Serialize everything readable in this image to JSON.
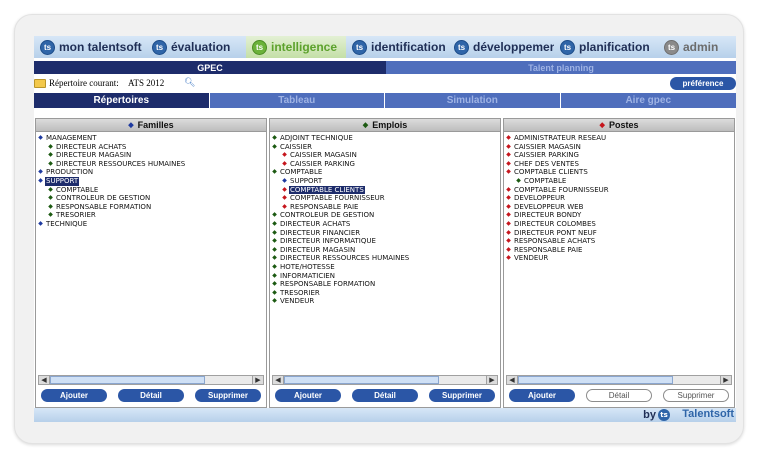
{
  "nav": {
    "items": [
      {
        "label": "mon talentsoft",
        "style": "normal"
      },
      {
        "label": "évaluation",
        "style": "normal"
      },
      {
        "label": "intelligence",
        "style": "active"
      },
      {
        "label": "identification",
        "style": "normal"
      },
      {
        "label": "développement",
        "style": "normal"
      },
      {
        "label": "planification",
        "style": "normal"
      },
      {
        "label": "admin",
        "style": "muted"
      }
    ]
  },
  "modules": {
    "gpec": "GPEC",
    "talent": "Talent planning"
  },
  "directory": {
    "label": "Répertoire courant:",
    "value": "ATS 2012",
    "preference": "préférence"
  },
  "tabs": [
    "Répertoires",
    "Tableau",
    "Simulation",
    "Aire gpec"
  ],
  "panels": [
    {
      "title": "Familles",
      "title_color": "blue",
      "items": [
        {
          "text": "MANAGEMENT",
          "level": 0,
          "color": "blue",
          "selected": false
        },
        {
          "text": "DIRECTEUR ACHATS",
          "level": 1,
          "color": "green",
          "selected": false
        },
        {
          "text": "DIRECTEUR MAGASIN",
          "level": 1,
          "color": "green",
          "selected": false
        },
        {
          "text": "DIRECTEUR RESSOURCES HUMAINES",
          "level": 1,
          "color": "green",
          "selected": false
        },
        {
          "text": "PRODUCTION",
          "level": 0,
          "color": "blue",
          "selected": false
        },
        {
          "text": "SUPPORT",
          "level": 0,
          "color": "blue",
          "selected": true
        },
        {
          "text": "COMPTABLE",
          "level": 1,
          "color": "green",
          "selected": false
        },
        {
          "text": "CONTROLEUR DE GESTION",
          "level": 1,
          "color": "green",
          "selected": false
        },
        {
          "text": "RESPONSABLE FORMATION",
          "level": 1,
          "color": "green",
          "selected": false
        },
        {
          "text": "TRESORIER",
          "level": 1,
          "color": "green",
          "selected": false
        },
        {
          "text": "TECHNIQUE",
          "level": 0,
          "color": "blue",
          "selected": false
        }
      ],
      "buttons": [
        "Ajouter",
        "Détail",
        "Supprimer"
      ]
    },
    {
      "title": "Emplois",
      "title_color": "green",
      "items": [
        {
          "text": "ADJOINT TECHNIQUE",
          "level": 0,
          "color": "green",
          "selected": false
        },
        {
          "text": "CAISSIER",
          "level": 0,
          "color": "green",
          "selected": false
        },
        {
          "text": "CAISSIER MAGASIN",
          "level": 1,
          "color": "red",
          "selected": false
        },
        {
          "text": "CAISSIER PARKING",
          "level": 1,
          "color": "red",
          "selected": false
        },
        {
          "text": "COMPTABLE",
          "level": 0,
          "color": "green",
          "selected": false
        },
        {
          "text": "SUPPORT",
          "level": 1,
          "color": "blue",
          "selected": false
        },
        {
          "text": "COMPTABLE CLIENTS",
          "level": 1,
          "color": "red",
          "selected": true
        },
        {
          "text": "COMPTABLE FOURNISSEUR",
          "level": 1,
          "color": "red",
          "selected": false
        },
        {
          "text": "RESPONSABLE PAIE",
          "level": 1,
          "color": "red",
          "selected": false
        },
        {
          "text": "CONTROLEUR DE GESTION",
          "level": 0,
          "color": "green",
          "selected": false
        },
        {
          "text": "DIRECTEUR ACHATS",
          "level": 0,
          "color": "green",
          "selected": false
        },
        {
          "text": "DIRECTEUR FINANCIER",
          "level": 0,
          "color": "green",
          "selected": false
        },
        {
          "text": "DIRECTEUR INFORMATIQUE",
          "level": 0,
          "color": "green",
          "selected": false
        },
        {
          "text": "DIRECTEUR MAGASIN",
          "level": 0,
          "color": "green",
          "selected": false
        },
        {
          "text": "DIRECTEUR RESSOURCES HUMAINES",
          "level": 0,
          "color": "green",
          "selected": false
        },
        {
          "text": "HOTE/HOTESSE",
          "level": 0,
          "color": "green",
          "selected": false
        },
        {
          "text": "INFORMATICIEN",
          "level": 0,
          "color": "green",
          "selected": false
        },
        {
          "text": "RESPONSABLE FORMATION",
          "level": 0,
          "color": "green",
          "selected": false
        },
        {
          "text": "TRESORIER",
          "level": 0,
          "color": "green",
          "selected": false
        },
        {
          "text": "VENDEUR",
          "level": 0,
          "color": "green",
          "selected": false
        }
      ],
      "buttons": [
        "Ajouter",
        "Détail",
        "Supprimer"
      ]
    },
    {
      "title": "Postes",
      "title_color": "red",
      "items": [
        {
          "text": "ADMINISTRATEUR RESEAU",
          "level": 0,
          "color": "red",
          "selected": false
        },
        {
          "text": "CAISSIER MAGASIN",
          "level": 0,
          "color": "red",
          "selected": false
        },
        {
          "text": "CAISSIER PARKING",
          "level": 0,
          "color": "red",
          "selected": false
        },
        {
          "text": "CHEF DES VENTES",
          "level": 0,
          "color": "red",
          "selected": false
        },
        {
          "text": "COMPTABLE CLIENTS",
          "level": 0,
          "color": "red",
          "selected": false
        },
        {
          "text": "COMPTABLE",
          "level": 1,
          "color": "green",
          "selected": false
        },
        {
          "text": "COMPTABLE FOURNISSEUR",
          "level": 0,
          "color": "red",
          "selected": false
        },
        {
          "text": "DEVELOPPEUR",
          "level": 0,
          "color": "red",
          "selected": false
        },
        {
          "text": "DEVELOPPEUR WEB",
          "level": 0,
          "color": "red",
          "selected": false
        },
        {
          "text": "DIRECTEUR BONDY",
          "level": 0,
          "color": "red",
          "selected": false
        },
        {
          "text": "DIRECTEUR COLOMBES",
          "level": 0,
          "color": "red",
          "selected": false
        },
        {
          "text": "DIRECTEUR PONT NEUF",
          "level": 0,
          "color": "red",
          "selected": false
        },
        {
          "text": "RESPONSABLE ACHATS",
          "level": 0,
          "color": "red",
          "selected": false
        },
        {
          "text": "RESPONSABLE PAIE",
          "level": 0,
          "color": "red",
          "selected": false
        },
        {
          "text": "VENDEUR",
          "level": 0,
          "color": "red",
          "selected": false
        }
      ],
      "buttons": [
        "Ajouter",
        "Détail",
        "Supprimer"
      ]
    }
  ],
  "footer": {
    "by": "by",
    "brand": "Talentsoft"
  },
  "colors": {
    "navy": "#1d2c6b",
    "mid_blue": "#4f6ebc",
    "accent_green": "#5da22d",
    "diamond_blue": "#1e3aa0",
    "diamond_green": "#1c5a12",
    "diamond_red": "#c6161d"
  }
}
